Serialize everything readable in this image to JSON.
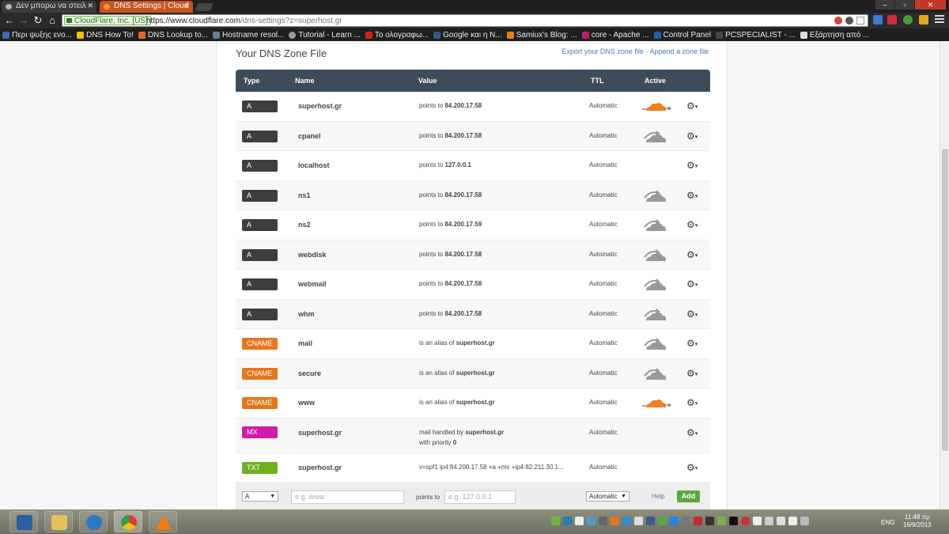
{
  "browser": {
    "tabs": [
      {
        "label": "Δεν μπορω να στειλ",
        "active": false
      },
      {
        "label": "DNS Settings | Cloud",
        "active": true
      }
    ],
    "ev_org": "CloudFlare, Inc. [US]",
    "url_host": "https://www.cloudflare.com",
    "url_path": "/dns-settings?z=superhost.gr",
    "bookmarks": [
      "Περι ψυξης ενο...",
      "DNS How To!",
      "DNS Lookup to...",
      "Hostname resol...",
      "Tutorial - Learn ...",
      "Το ολογραφω...",
      "Google και η Ν...",
      "Samiux's Blog: ...",
      "core - Apache ...",
      "Control Panel",
      "PCSPECIALIST - ...",
      "Εξάρτηση από ..."
    ]
  },
  "zone": {
    "title": "Your DNS Zone File",
    "export_link": "Export your DNS zone file",
    "separator": "·",
    "append_link": "Append a zone file"
  },
  "table": {
    "headers": {
      "type": "Type",
      "name": "Name",
      "value": "Value",
      "ttl": "TTL",
      "active": "Active"
    },
    "records": [
      {
        "type": "A",
        "name": "superhost.gr",
        "prefix": "points to",
        "target": "84.200.17.58",
        "ttl": "Automatic",
        "cloud": "orange"
      },
      {
        "type": "A",
        "name": "cpanel",
        "prefix": "points to",
        "target": "84.200.17.58",
        "ttl": "Automatic",
        "cloud": "gray"
      },
      {
        "type": "A",
        "name": "localhost",
        "prefix": "points to",
        "target": "127.0.0.1",
        "ttl": "Automatic",
        "cloud": "none"
      },
      {
        "type": "A",
        "name": "ns1",
        "prefix": "points to",
        "target": "84.200.17.58",
        "ttl": "Automatic",
        "cloud": "gray"
      },
      {
        "type": "A",
        "name": "ns2",
        "prefix": "points to",
        "target": "84.200.17.59",
        "ttl": "Automatic",
        "cloud": "gray"
      },
      {
        "type": "A",
        "name": "webdisk",
        "prefix": "points to",
        "target": "84.200.17.58",
        "ttl": "Automatic",
        "cloud": "gray"
      },
      {
        "type": "A",
        "name": "webmail",
        "prefix": "points to",
        "target": "84.200.17.58",
        "ttl": "Automatic",
        "cloud": "gray"
      },
      {
        "type": "A",
        "name": "whm",
        "prefix": "points to",
        "target": "84.200.17.58",
        "ttl": "Automatic",
        "cloud": "gray"
      },
      {
        "type": "CNAME",
        "name": "mail",
        "prefix": "is an alias of",
        "target": "superhost.gr",
        "ttl": "Automatic",
        "cloud": "gray"
      },
      {
        "type": "CNAME",
        "name": "secure",
        "prefix": "is an alias of",
        "target": "superhost.gr",
        "ttl": "Automatic",
        "cloud": "gray"
      },
      {
        "type": "CNAME",
        "name": "www",
        "prefix": "is an alias of",
        "target": "superhost.gr",
        "ttl": "Automatic",
        "cloud": "orange"
      },
      {
        "type": "MX",
        "name": "superhost.gr",
        "prefix": "mail handled by",
        "target": "superhost.gr",
        "extra_prefix": "with priority",
        "extra_value": "0",
        "ttl": "Automatic",
        "cloud": "none"
      },
      {
        "type": "TXT",
        "name": "superhost.gr",
        "prefix": "v=spf1 ip4:84.200.17.58 +a +mx +ip4:82.211.30.1...",
        "target": "",
        "ttl": "Automatic",
        "cloud": "none"
      }
    ]
  },
  "add_form": {
    "type_value": "A",
    "name_placeholder": "e.g. www",
    "points_label": "points to",
    "value_placeholder": "e.g. 127.0.0.1",
    "ttl_value": "Automatic",
    "help_label": "Help",
    "add_label": "Add"
  },
  "taskbar": {
    "lang": "ENG",
    "time": "11:48 πμ",
    "date": "16/9/2013"
  },
  "colors": {
    "A": "#3e3e3e",
    "CNAME": "#e6761a",
    "MX": "#d21cab",
    "TXT": "#6eb11d",
    "cloud_on": "#f38020",
    "cloud_off": "#999999",
    "header_bg": "#3d4c5a"
  }
}
